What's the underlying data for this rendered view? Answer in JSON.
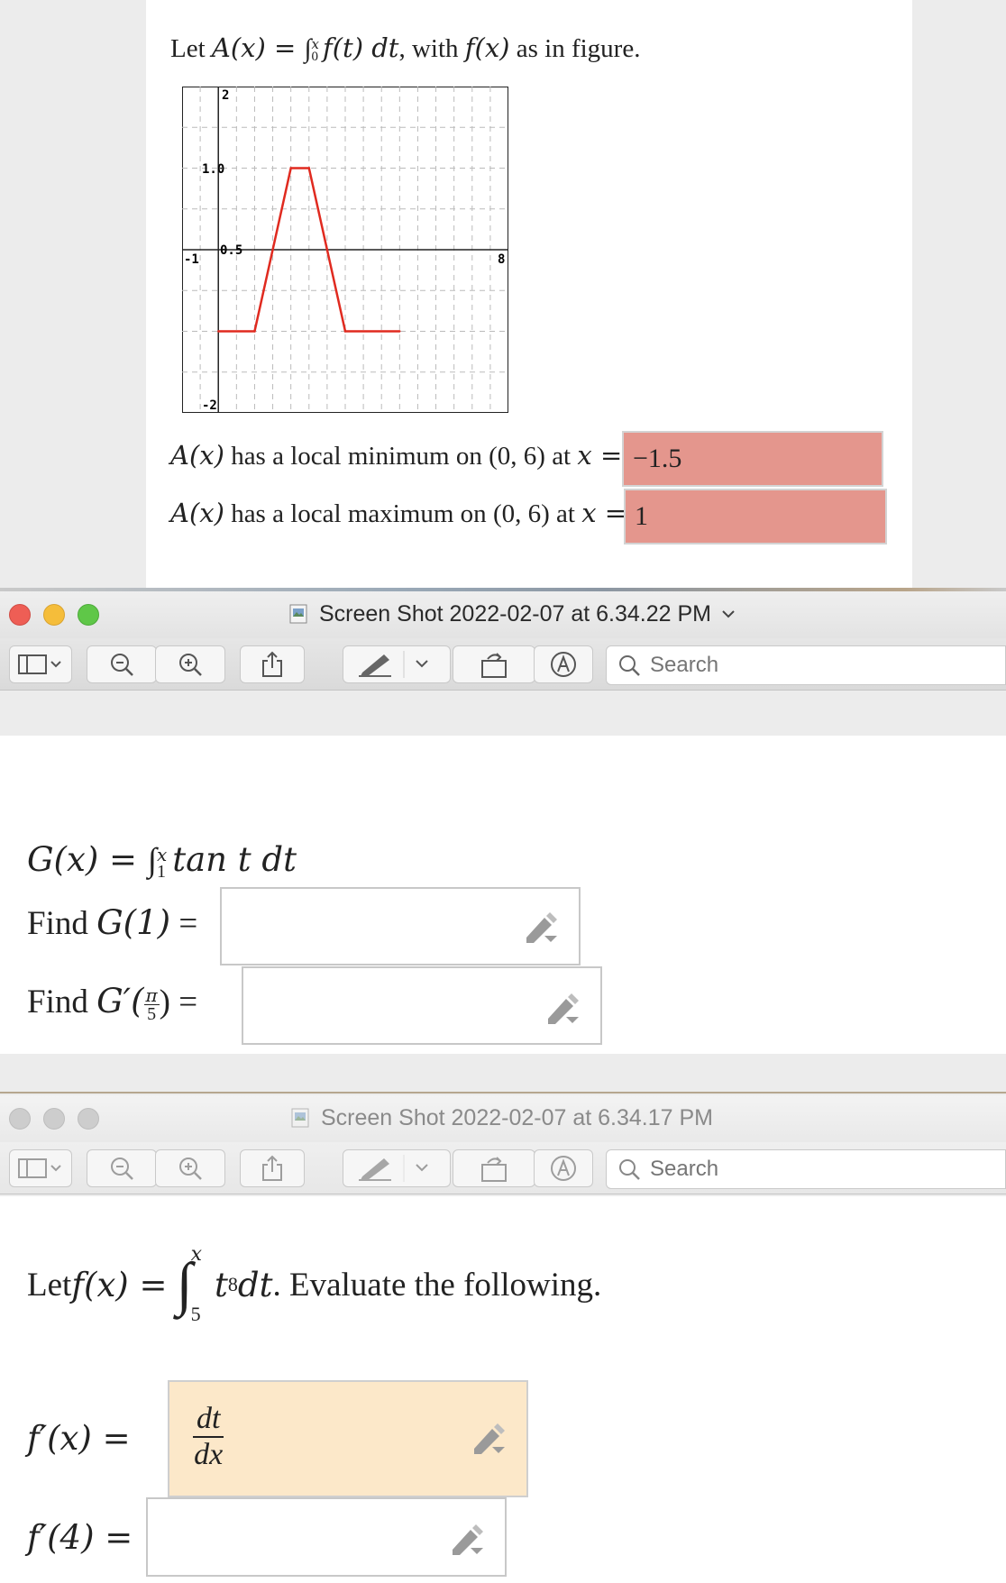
{
  "section1": {
    "prompt": {
      "lead": "Let ",
      "func": "A(x) = ",
      "int_upper": "x",
      "int_lower": "0",
      "integrand": "f(t) dt",
      "mid": ", with ",
      "fx": "f(x)",
      "tail": " as in figure."
    },
    "graph": {
      "tick_labels": {
        "y_top": "2",
        "y_upper": "1.0",
        "y_mid": "0.5",
        "y_bottom": "-2",
        "x_left": "-1",
        "x_right": "8"
      }
    },
    "min_line": {
      "ax": "A(x)",
      "text1": " has a local minimum on ",
      "interval": "(0, 6)",
      "text2": " at ",
      "xeq": "x ="
    },
    "min_answer": "−1.5",
    "max_line": {
      "ax": "A(x)",
      "text1": " has a local maximum on ",
      "interval": "(0, 6)",
      "text2": " at ",
      "xeq": "x ="
    },
    "max_answer": "1",
    "answer_color": "#e4968d"
  },
  "chart_data": {
    "type": "line",
    "series": [
      {
        "values": [
          [
            0,
            -1
          ],
          [
            1,
            -1
          ],
          [
            2,
            1
          ],
          [
            2.5,
            1
          ],
          [
            3.5,
            -1
          ],
          [
            5,
            -1
          ]
        ]
      }
    ],
    "xlim": [
      -1,
      8
    ],
    "ylim": [
      -2,
      2
    ],
    "grid": true,
    "tick_labels_x": [
      "-1",
      "8"
    ],
    "tick_labels_y": [
      "2",
      "1.0",
      "0.5",
      "-2"
    ],
    "line_color": "#e02a1f"
  },
  "window1": {
    "title": "Screen Shot 2022-02-07 at 6.34.22 PM",
    "title_chevron": "chevron-down",
    "search_placeholder": "Search"
  },
  "section2": {
    "def": {
      "lhs": "G(x) = ",
      "upper": "x",
      "lower": "1",
      "integrand": "tan t dt"
    },
    "q1": {
      "label": "Find ",
      "expr": "G(1)",
      "eq": " ="
    },
    "q2": {
      "label": "Find ",
      "expr_pre": "G′(",
      "frac_num": "π",
      "frac_den": "5",
      "expr_post": ")",
      "eq": " ="
    },
    "q1_value": "",
    "q2_value": ""
  },
  "window2": {
    "title": "Screen Shot 2022-02-07 at 6.34.17 PM",
    "search_placeholder": "Search"
  },
  "section3": {
    "prompt": {
      "lead": "Let ",
      "fx": "f(x) = ",
      "upper": "x",
      "lower": "5",
      "integrand_base": "t",
      "integrand_exp": "8",
      "dt": "dt",
      "tail": ". Evaluate the following."
    },
    "q1": {
      "expr": "f′(x) ="
    },
    "q1_answer": {
      "num": "dt",
      "den": "dx"
    },
    "q1_color": "#fce8c9",
    "q2": {
      "expr": "f′(4) ="
    },
    "q2_value": ""
  }
}
